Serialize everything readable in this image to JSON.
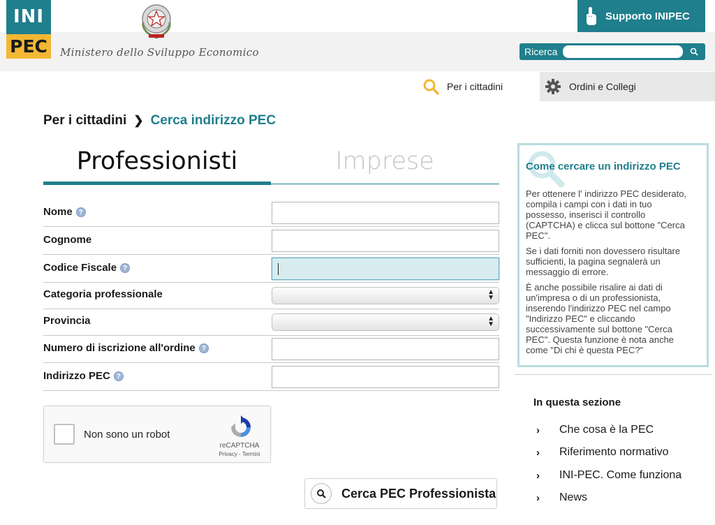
{
  "header": {
    "logo_top": "INI",
    "logo_bottom": "PEC",
    "ministry": "Ministero dello Sviluppo Economico",
    "support_label": "Supporto INIPEC",
    "search_label": "Ricerca",
    "search_value": "",
    "accent_color": "#1f7f8c",
    "logo_yellow": "#f2b733"
  },
  "nav": {
    "citizens": "Per i cittadini",
    "orders": "Ordini e Collegi"
  },
  "breadcrumb": {
    "parent": "Per i cittadini",
    "current": "Cerca indirizzo PEC"
  },
  "tabs": {
    "professionals": "Professionisti",
    "companies": "Imprese"
  },
  "form": {
    "fields": [
      {
        "label": "Nome",
        "help": true,
        "type": "text",
        "value": ""
      },
      {
        "label": "Cognome",
        "help": false,
        "type": "text",
        "value": ""
      },
      {
        "label": "Codice Fiscale",
        "help": true,
        "type": "text",
        "value": ""
      },
      {
        "label": "Categoria professionale",
        "help": false,
        "type": "select",
        "value": ""
      },
      {
        "label": "Provincia",
        "help": false,
        "type": "select",
        "value": ""
      },
      {
        "label": "Numero di iscrizione all'ordine",
        "help": true,
        "type": "text",
        "value": ""
      },
      {
        "label": "Indirizzo PEC",
        "help": true,
        "type": "text",
        "value": ""
      }
    ],
    "help_glyph": "?"
  },
  "captcha": {
    "label": "Non sono un robot",
    "brand": "reCAPTCHA",
    "links": "Privacy - Termini"
  },
  "search_button": "Cerca PEC Professionista",
  "help_box": {
    "title": "Come cercare un indirizzo PEC",
    "p1": "Per ottenere l' indirizzo PEC desiderato, compila i campi con i dati in tuo possesso, inserisci il controllo (CAPTCHA) e clicca sul bottone \"Cerca PEC\".",
    "p2": "Se i dati forniti non dovessero risultare sufficienti, la pagina segnalerà un messaggio di errore.",
    "p3": "È anche possibile risalire ai dati di un'impresa o di un professionista, inserendo l'indirizzo PEC nel campo \"Indirizzo PEC\" e cliccando successivamente  sul bottone \"Cerca PEC\". Questa funzione è nota anche come \"Di chi è questa PEC?\""
  },
  "section": {
    "title": "In questa sezione",
    "items": [
      "Che cosa è la PEC",
      "Riferimento normativo",
      "INI-PEC. Come funziona",
      "News"
    ],
    "chevron": "›"
  }
}
